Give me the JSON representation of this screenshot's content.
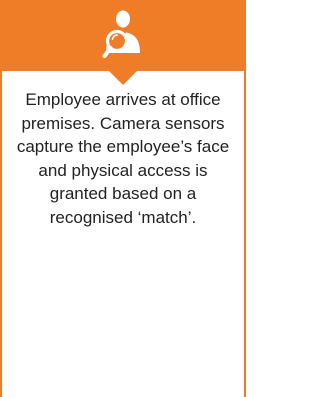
{
  "icon": {
    "name": "employee-search-icon"
  },
  "colors": {
    "accent": "#ef7d28",
    "text": "#222222",
    "background": "#ffffff"
  },
  "card": {
    "description": "Employee arrives at office premises. Camera sensors capture the employee’s face and physical access is granted based on a recognised ‘match’."
  }
}
